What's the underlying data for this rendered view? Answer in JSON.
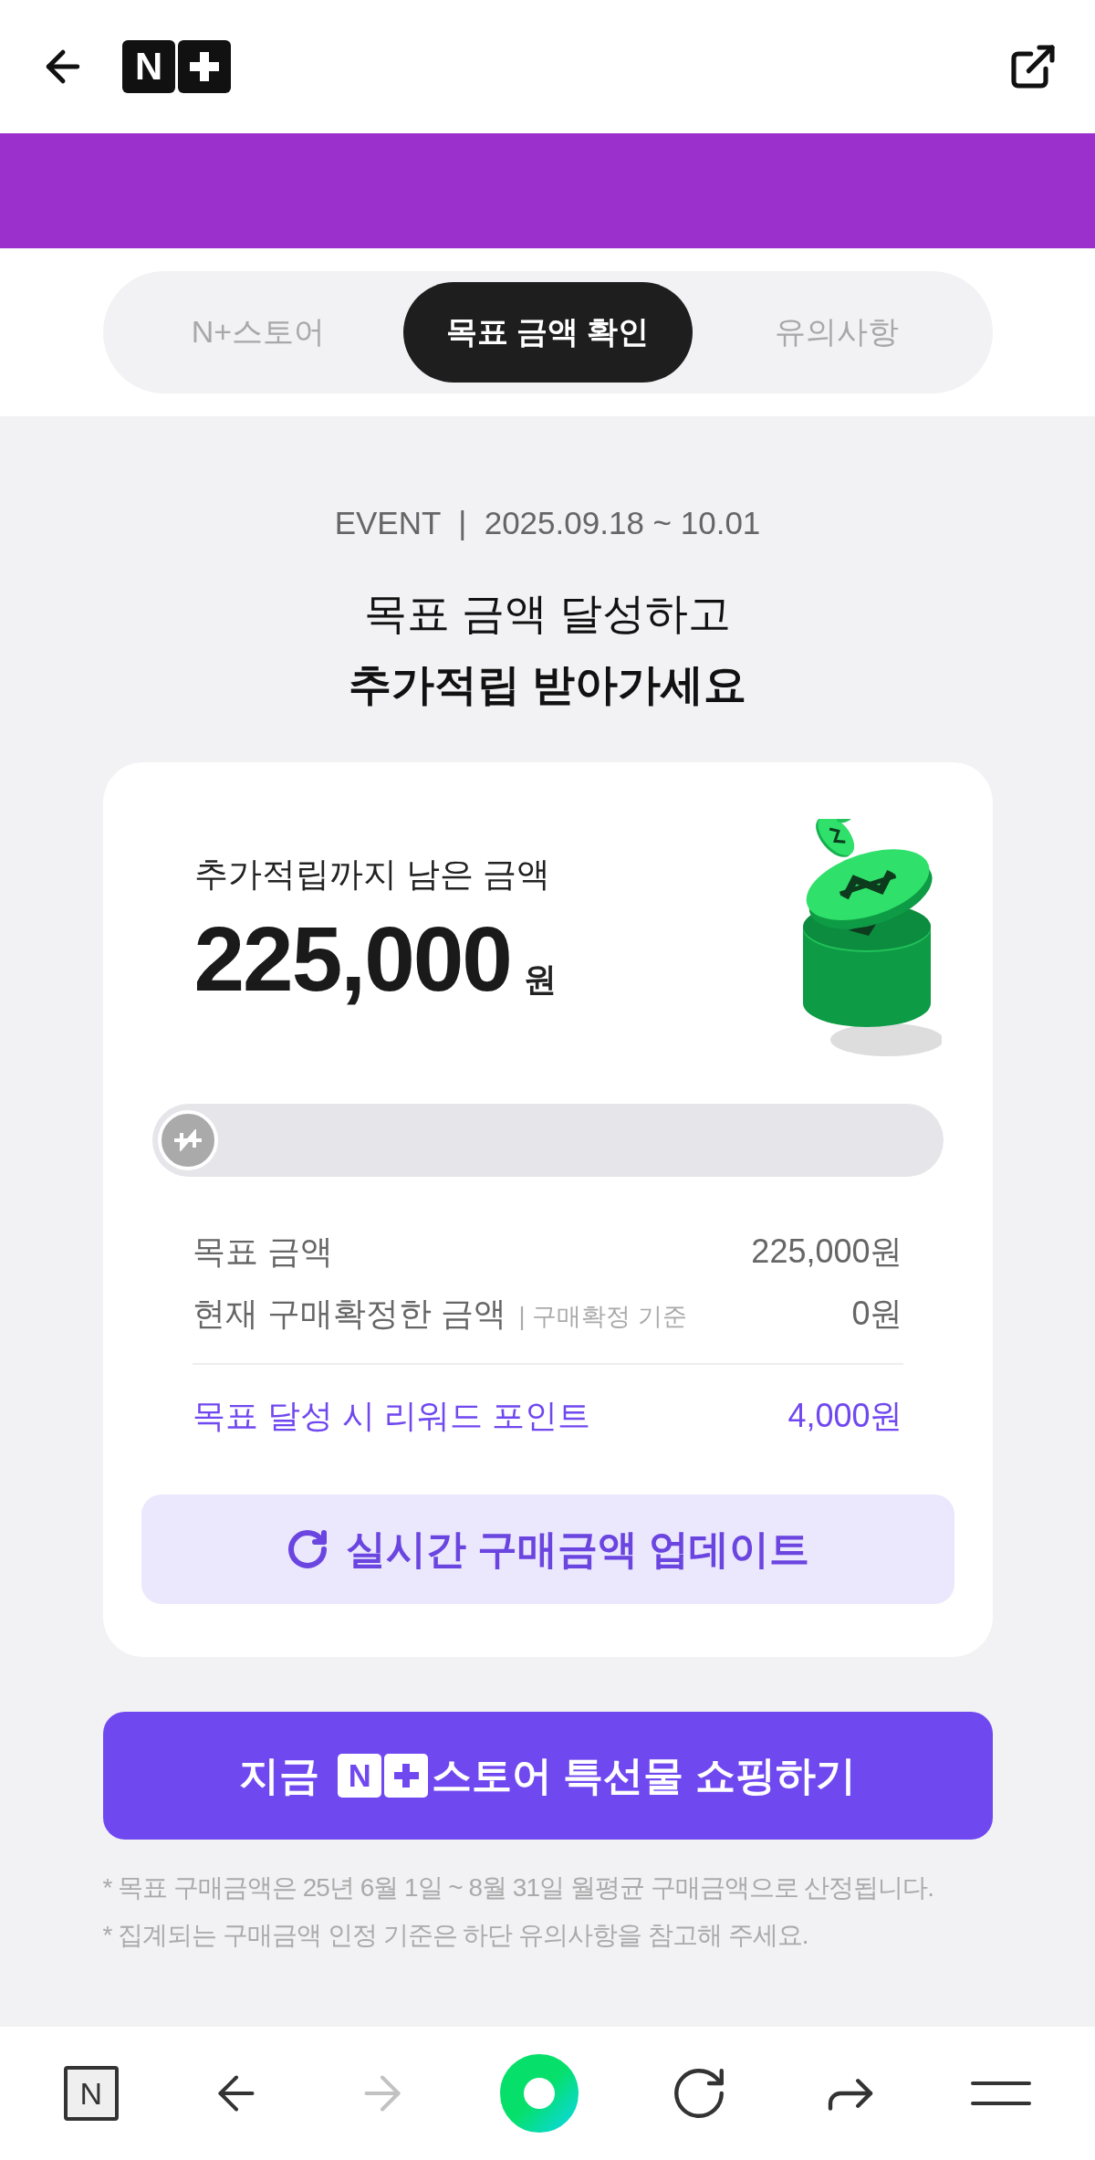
{
  "header": {
    "logo_letter": "N"
  },
  "tabs": [
    {
      "label": "N+스토어",
      "selected": false
    },
    {
      "label": "목표 금액 확인",
      "selected": true
    },
    {
      "label": "유의사항",
      "selected": false
    }
  ],
  "event_line": "EVENT  |  2025.09.18 ~ 10.01",
  "headline": [
    "목표 금액 달성하고",
    "추가적립 받아가세요"
  ],
  "card": {
    "remaining_label": "추가적립까지 남은 금액",
    "remaining_amount": "225,000",
    "remaining_unit": "원",
    "progress": {
      "level": 0
    },
    "rows": [
      {
        "kind": "plain",
        "label": "목표 금액",
        "value": "225,000원"
      },
      {
        "kind": "plain",
        "label": "현재 구매확정한 금액",
        "note": "| 구매확정 기준",
        "value": "0원"
      },
      {
        "kind": "reward",
        "label": "목표 달성 시 리워드 포인트",
        "value": "4,000원"
      }
    ],
    "update_button": "실시간 구매금액 업데이트"
  },
  "shop_button": {
    "before": "지금",
    "logo_letter": "N",
    "after": "스토어 특선물 쇼핑하기"
  },
  "notes": [
    "* 목표 구매금액은 25년 6월 1일 ~ 8월 31일 월평균 구매금액으로 산정됩니다.",
    "* 집계되는 구매금액 인정 기준은 하단 유의사항을 참고해 주세요."
  ],
  "bottom_nav": [
    {
      "kind": "home",
      "label": "N"
    },
    {
      "kind": "back",
      "disabled": false
    },
    {
      "kind": "forward",
      "disabled": true
    },
    {
      "kind": "dot"
    },
    {
      "kind": "reload"
    },
    {
      "kind": "share"
    },
    {
      "kind": "menu"
    }
  ]
}
